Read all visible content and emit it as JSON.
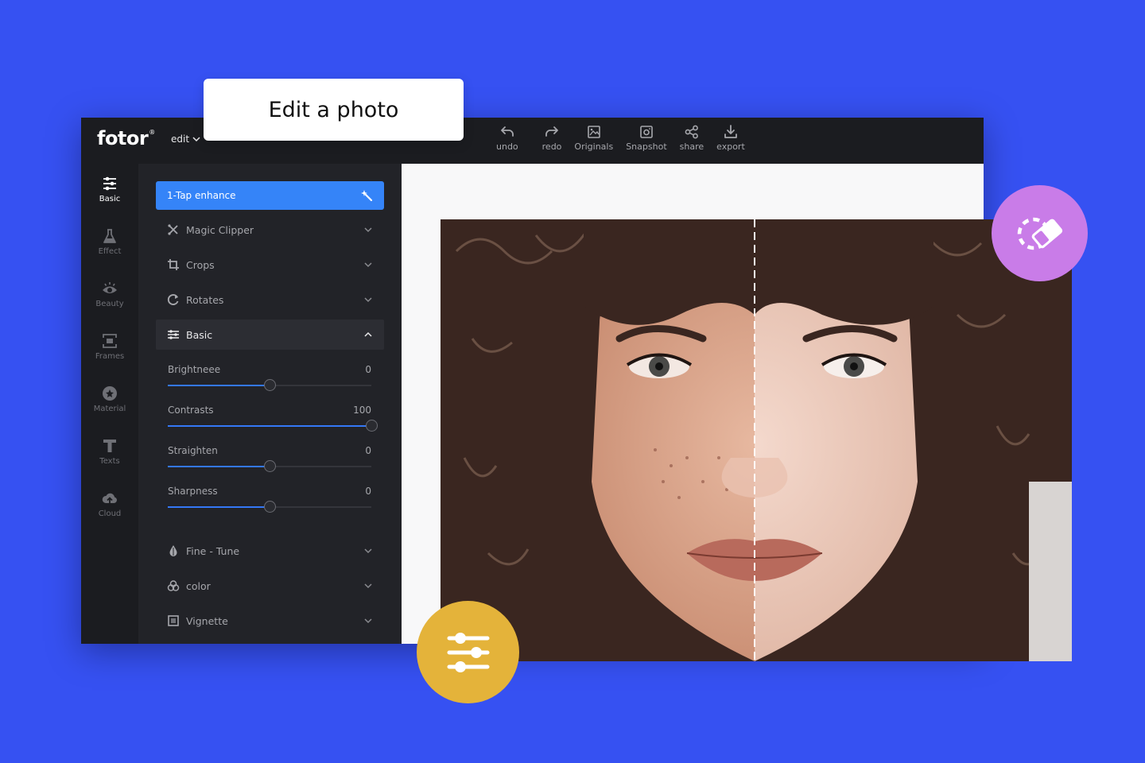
{
  "callout": {
    "title": "Edit a photo"
  },
  "topbar": {
    "logo": "fotor",
    "logo_mark": "®",
    "edit_menu": "edit",
    "tools": [
      {
        "label": "undo",
        "icon": "undo-icon"
      },
      {
        "label": "redo",
        "icon": "redo-icon"
      },
      {
        "label": "Originals",
        "icon": "image-icon"
      },
      {
        "label": "Snapshot",
        "icon": "camera-icon"
      },
      {
        "label": "share",
        "icon": "share-icon"
      },
      {
        "label": "export",
        "icon": "download-icon"
      }
    ]
  },
  "rail": {
    "items": [
      {
        "label": "Basic",
        "icon": "sliders-icon",
        "active": true
      },
      {
        "label": "Effect",
        "icon": "flask-icon"
      },
      {
        "label": "Beauty",
        "icon": "eye-icon"
      },
      {
        "label": "Frames",
        "icon": "frame-icon"
      },
      {
        "label": "Material",
        "icon": "star-circle-icon"
      },
      {
        "label": "Texts",
        "icon": "text-icon"
      },
      {
        "label": "Cloud",
        "icon": "cloud-upload-icon"
      }
    ]
  },
  "panel": {
    "enhance_label": "1-Tap enhance",
    "sections": [
      {
        "label": "Magic Clipper",
        "icon": "scissors-icon",
        "open": false
      },
      {
        "label": "Crops",
        "icon": "crop-icon",
        "open": false
      },
      {
        "label": "Rotates",
        "icon": "rotate-icon",
        "open": false
      },
      {
        "label": "Basic",
        "icon": "sliders-icon",
        "open": true
      },
      {
        "label": "Fine - Tune",
        "icon": "drop-icon",
        "open": false
      },
      {
        "label": "color",
        "icon": "color-circles-icon",
        "open": false
      },
      {
        "label": "Vignette",
        "icon": "vignette-icon",
        "open": false
      }
    ],
    "sliders": [
      {
        "label": "Brightneee",
        "value": "0",
        "fraction": 0.5
      },
      {
        "label": "Contrasts",
        "value": "100",
        "fraction": 1.0
      },
      {
        "label": "Straighten",
        "value": "0",
        "fraction": 0.5
      },
      {
        "label": "Sharpness",
        "value": "0",
        "fraction": 0.5
      }
    ]
  },
  "colors": {
    "background": "#3651f2",
    "accent": "#3584f8",
    "eraser_badge": "#c97ce8",
    "adjust_badge": "#e4b33a"
  }
}
